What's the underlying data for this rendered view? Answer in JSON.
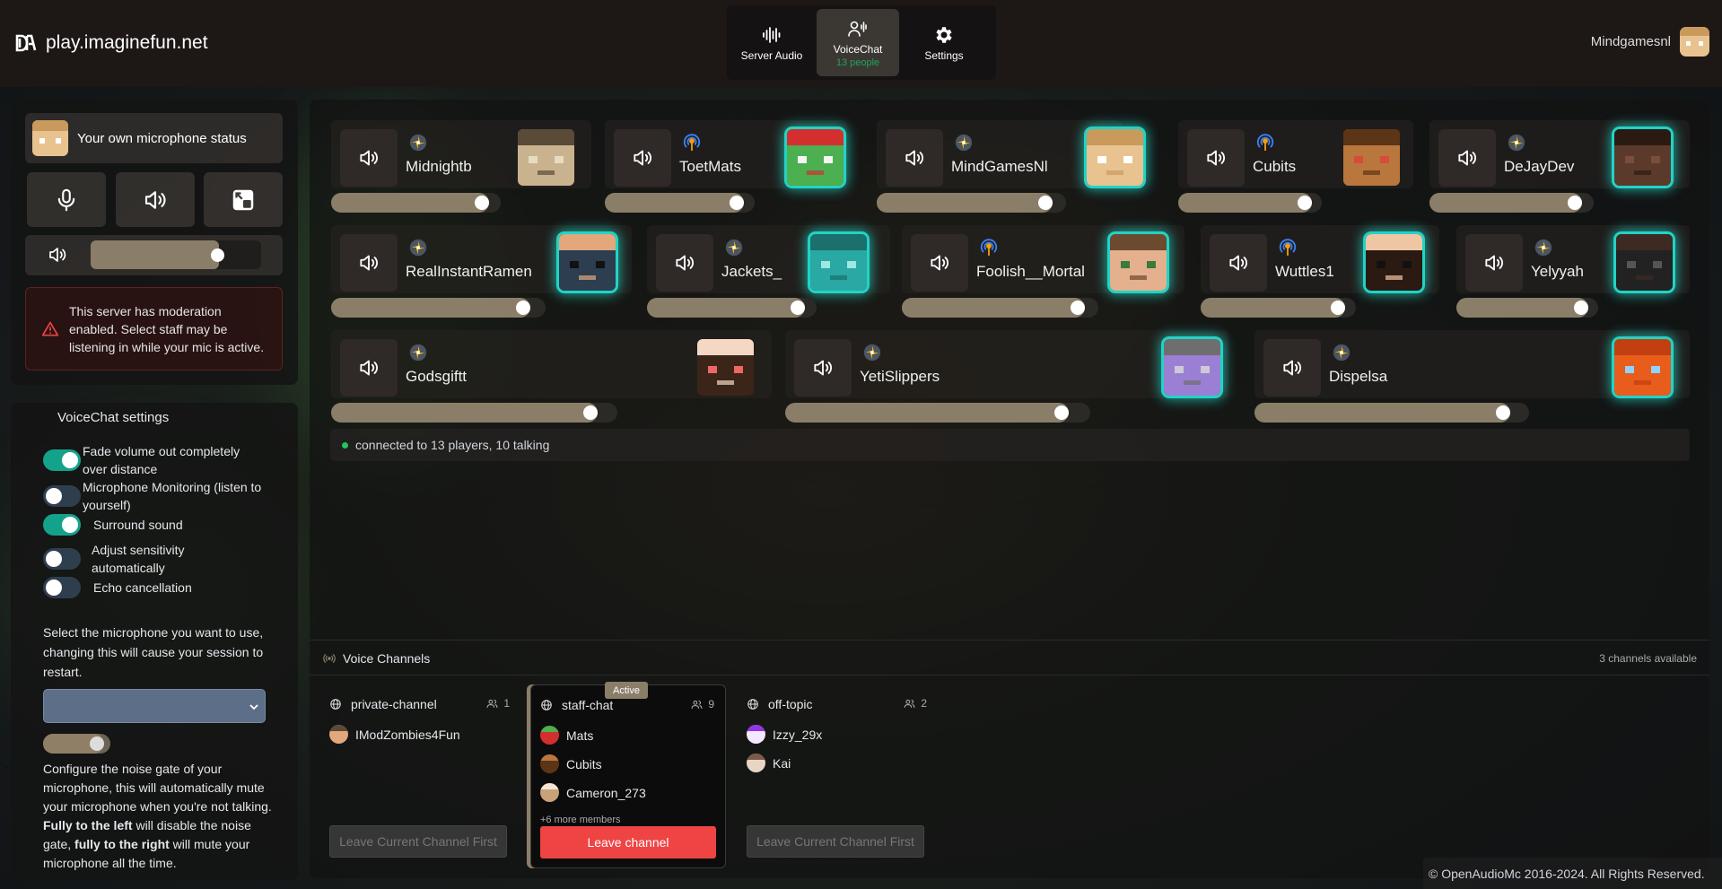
{
  "app": {
    "domain": "play.imaginefun.net"
  },
  "nav": {
    "tabs": [
      {
        "label": "Server Audio",
        "icon": "waveform-icon"
      },
      {
        "label": "VoiceChat",
        "sub": "13 people",
        "icon": "people-wave-icon",
        "active": true
      },
      {
        "label": "Settings",
        "icon": "gear-icon"
      }
    ]
  },
  "user": {
    "name": "Mindgamesnl"
  },
  "mic": {
    "status_label": "Your own microphone status",
    "volume_percent": 75,
    "warning": "This server has moderation enabled. Select staff may be listening in while your mic is active."
  },
  "settings": {
    "title": "VoiceChat settings",
    "toggles": [
      {
        "label": "Fade volume out completely over distance",
        "on": true
      },
      {
        "label": "Microphone Monitoring (listen to yourself)",
        "on": false
      },
      {
        "label": "Surround sound",
        "on": true
      },
      {
        "label": "Adjust sensitivity automatically",
        "on": false
      },
      {
        "label": "Echo cancellation",
        "on": false
      }
    ],
    "mic_select_text": "Select the microphone you want to use, changing this will cause your session to restart.",
    "mic_selected": "",
    "noise_gate_percent": 90,
    "noise_gate_text_1": "Configure the noise gate of your microphone, this will automatically mute your microphone when you're not talking. ",
    "noise_gate_bold_1": "Fully to the left",
    "noise_gate_text_2": " will disable the noise gate, ",
    "noise_gate_bold_2": "fully to the right",
    "noise_gate_text_3": " will mute your microphone all the time."
  },
  "players": [
    {
      "name": "Midnightb",
      "status": "yellow",
      "volume": 93,
      "glow": false
    },
    {
      "name": "ToetMats",
      "status": "blue",
      "volume": 93,
      "glow": true
    },
    {
      "name": "MindGamesNl",
      "status": "yellow",
      "volume": 93,
      "glow": true
    },
    {
      "name": "Cubits",
      "status": "blue",
      "volume": 93,
      "glow": false
    },
    {
      "name": "DeJayDev",
      "status": "yellow",
      "volume": 93,
      "glow": true
    },
    {
      "name": "RealInstantRamen",
      "status": "yellow",
      "volume": 93,
      "glow": true
    },
    {
      "name": "Jackets_",
      "status": "yellow",
      "volume": 93,
      "glow": true
    },
    {
      "name": "Foolish__Mortal",
      "status": "blue",
      "volume": 93,
      "glow": true
    },
    {
      "name": "Wuttles1",
      "status": "blue",
      "volume": 93,
      "glow": true
    },
    {
      "name": "Yelyyah",
      "status": "yellow",
      "volume": 93,
      "glow": true
    },
    {
      "name": "Godsgiftt",
      "status": "yellow",
      "volume": 93,
      "glow": false
    },
    {
      "name": "YetiSlippers",
      "status": "yellow",
      "volume": 93,
      "glow": true
    },
    {
      "name": "Dispelsa",
      "status": "yellow",
      "volume": 93,
      "glow": true
    }
  ],
  "connection": {
    "text": "connected to 13 players, 10 talking"
  },
  "channels_header": {
    "title": "Voice Channels",
    "available": "3 channels available"
  },
  "channels": [
    {
      "name": "private-channel",
      "count": "1",
      "members": [
        "IModZombies4Fun"
      ],
      "more": "",
      "button": "Leave Current Channel First",
      "active": false
    },
    {
      "name": "staff-chat",
      "count": "9",
      "members": [
        "Mats",
        "Cubits",
        "Cameron_273"
      ],
      "more": "+6 more members",
      "button": "Leave channel",
      "active": true,
      "badge": "Active"
    },
    {
      "name": "off-topic",
      "count": "2",
      "members": [
        "Izzy_29x",
        "Kai"
      ],
      "more": "",
      "button": "Leave Current Channel First",
      "active": false
    }
  ],
  "footer": {
    "text": "© OpenAudioMc 2016-2024. All Rights Reserved."
  },
  "colors": {
    "accent": "#8b7e69",
    "toggle_on": "#14a38a",
    "glow": "#22d3c5",
    "danger": "#ef4444",
    "online": "#22c55e"
  }
}
